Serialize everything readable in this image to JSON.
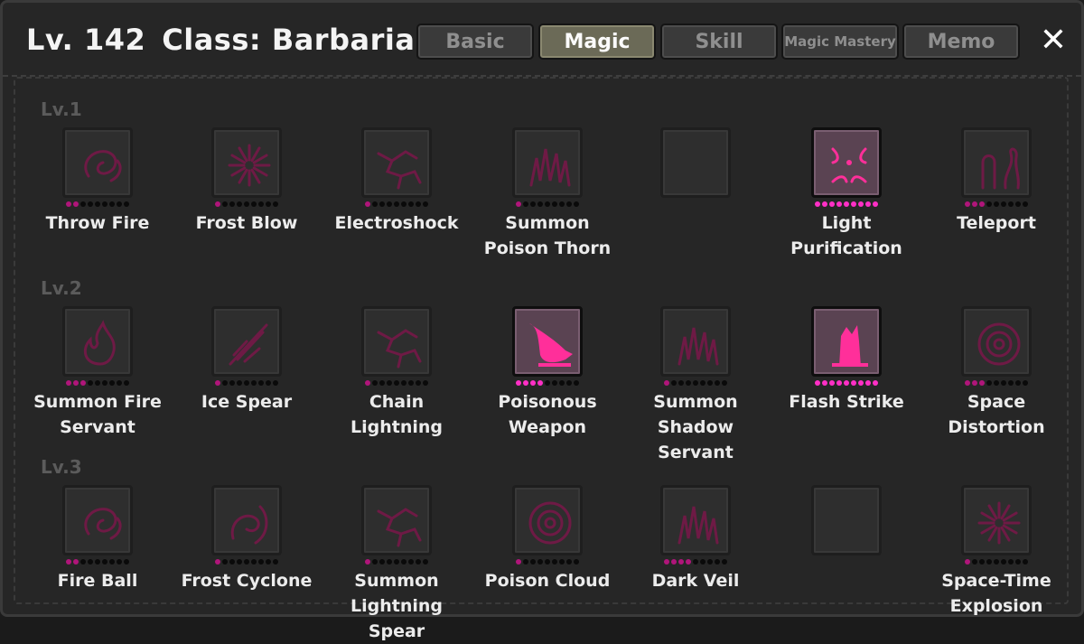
{
  "header": {
    "level": "Lv. 142",
    "class_name": "Class: Barbarian",
    "close_icon": "close-icon"
  },
  "tabs": [
    {
      "label": "Basic",
      "active": false
    },
    {
      "label": "Magic",
      "active": true
    },
    {
      "label": "Skill",
      "active": false
    },
    {
      "label": "Magic Mastery",
      "active": false
    },
    {
      "label": "Memo",
      "active": false
    }
  ],
  "colors": {
    "accent_dim": "#b0157a",
    "accent_bright": "#ff2fc6",
    "icon_art_dim": "#6e1a45",
    "icon_art_bright": "#ff2f9a"
  },
  "levels": [
    {
      "label": "Lv.1",
      "skills": [
        {
          "name": "Throw Fire",
          "icon": "fire-swirl-icon",
          "points": 2,
          "max": 9,
          "lit": false,
          "empty": false
        },
        {
          "name": "Frost Blow",
          "icon": "frost-burst-icon",
          "points": 1,
          "max": 9,
          "lit": false,
          "empty": false
        },
        {
          "name": "Electroshock",
          "icon": "lightning-crack-icon",
          "points": 1,
          "max": 9,
          "lit": false,
          "empty": false
        },
        {
          "name": "Summon Poison Thorn",
          "icon": "poison-thorn-icon",
          "points": 1,
          "max": 9,
          "lit": false,
          "empty": false
        },
        {
          "name": "",
          "icon": "empty-slot-icon",
          "points": 0,
          "max": 0,
          "lit": false,
          "empty": true
        },
        {
          "name": "Light Purification",
          "icon": "light-purification-icon",
          "points": 9,
          "max": 9,
          "lit": true,
          "empty": false
        },
        {
          "name": "Teleport",
          "icon": "teleport-icon",
          "points": 3,
          "max": 9,
          "lit": false,
          "empty": false
        }
      ]
    },
    {
      "label": "Lv.2",
      "skills": [
        {
          "name": "Summon Fire Servant",
          "icon": "fire-servant-icon",
          "points": 3,
          "max": 9,
          "lit": false,
          "empty": false
        },
        {
          "name": "Ice Spear",
          "icon": "ice-spear-icon",
          "points": 1,
          "max": 9,
          "lit": false,
          "empty": false
        },
        {
          "name": "Chain Lightning",
          "icon": "chain-lightning-icon",
          "points": 1,
          "max": 9,
          "lit": false,
          "empty": false
        },
        {
          "name": "Poisonous Weapon",
          "icon": "poisonous-weapon-icon",
          "points": 4,
          "max": 9,
          "lit": true,
          "empty": false
        },
        {
          "name": "Summon Shadow Servant",
          "icon": "shadow-servant-icon",
          "points": 1,
          "max": 9,
          "lit": false,
          "empty": false
        },
        {
          "name": "Flash Strike",
          "icon": "flash-strike-icon",
          "points": 9,
          "max": 9,
          "lit": true,
          "empty": false
        },
        {
          "name": "Space Distortion",
          "icon": "space-distortion-icon",
          "points": 3,
          "max": 9,
          "lit": false,
          "empty": false
        }
      ]
    },
    {
      "label": "Lv.3",
      "skills": [
        {
          "name": "Fire Ball",
          "icon": "fire-ball-icon",
          "points": 2,
          "max": 9,
          "lit": false,
          "empty": false
        },
        {
          "name": "Frost Cyclone",
          "icon": "frost-cyclone-icon",
          "points": 1,
          "max": 9,
          "lit": false,
          "empty": false
        },
        {
          "name": "Summon Lightning Spear",
          "icon": "lightning-spear-icon",
          "points": 1,
          "max": 9,
          "lit": false,
          "empty": false
        },
        {
          "name": "Poison Cloud",
          "icon": "poison-cloud-icon",
          "points": 1,
          "max": 9,
          "lit": false,
          "empty": false
        },
        {
          "name": "Dark Veil",
          "icon": "dark-veil-icon",
          "points": 4,
          "max": 9,
          "lit": false,
          "empty": false
        },
        {
          "name": "",
          "icon": "empty-slot-icon",
          "points": 0,
          "max": 0,
          "lit": false,
          "empty": true
        },
        {
          "name": "Space-Time Explosion",
          "icon": "space-time-explosion-icon",
          "points": 1,
          "max": 9,
          "lit": false,
          "empty": false
        }
      ]
    }
  ]
}
